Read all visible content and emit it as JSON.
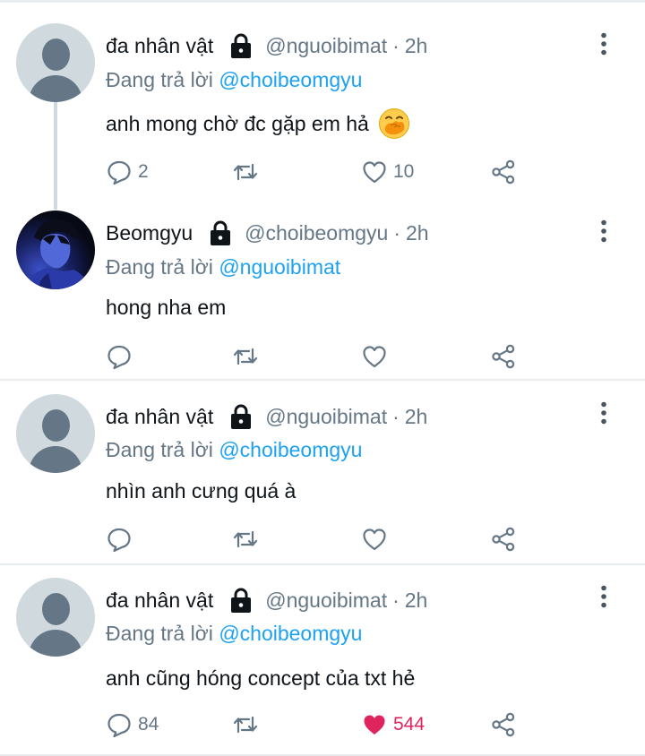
{
  "colors": {
    "text": "#0f1419",
    "secondary": "#657786",
    "mention": "#1da1f2",
    "like_active": "#e0245e",
    "divider": "#e6ecf0",
    "default_avatar_bg": "#cfd9de",
    "default_avatar_fg": "#657786"
  },
  "tweets": [
    {
      "display_name": "đa nhân vật",
      "handle": "@nguoibimat",
      "dot": "·",
      "time": "2h",
      "reply_prefix": "Đang trả lời",
      "reply_to": "@choibeomgyu",
      "text": "anh mong chờ đc gặp em hả",
      "emoji": "face-with-hand-over-mouth-emoji",
      "reply_count": "2",
      "retweet_count": "",
      "like_count": "10",
      "liked": false,
      "avatar": "default-avatar-icon",
      "locked": true
    },
    {
      "display_name": "Beomgyu",
      "handle": "@choibeomgyu",
      "dot": "·",
      "time": "2h",
      "reply_prefix": "Đang trả lời",
      "reply_to": "@nguoibimat",
      "text": "hong nha em",
      "reply_count": "",
      "retweet_count": "",
      "like_count": "",
      "liked": false,
      "avatar": "profile-photo",
      "locked": true
    },
    {
      "display_name": "đa nhân vật",
      "handle": "@nguoibimat",
      "dot": "·",
      "time": "2h",
      "reply_prefix": "Đang trả lời",
      "reply_to": "@choibeomgyu",
      "text": "nhìn anh cưng quá à",
      "reply_count": "",
      "retweet_count": "",
      "like_count": "",
      "liked": false,
      "avatar": "default-avatar-icon",
      "locked": true
    },
    {
      "display_name": "đa nhân vật",
      "handle": "@nguoibimat",
      "dot": "·",
      "time": "2h",
      "reply_prefix": "Đang trả lời",
      "reply_to": "@choibeomgyu",
      "text": "anh cũng hóng concept của txt hẻ",
      "reply_count": "84",
      "retweet_count": "",
      "like_count": "544",
      "liked": true,
      "avatar": "default-avatar-icon",
      "locked": true
    }
  ],
  "icons": {
    "lock": "lock-icon",
    "more": "more-vertical-icon",
    "reply": "reply-icon",
    "retweet": "retweet-icon",
    "like": "heart-icon",
    "share": "share-icon"
  }
}
